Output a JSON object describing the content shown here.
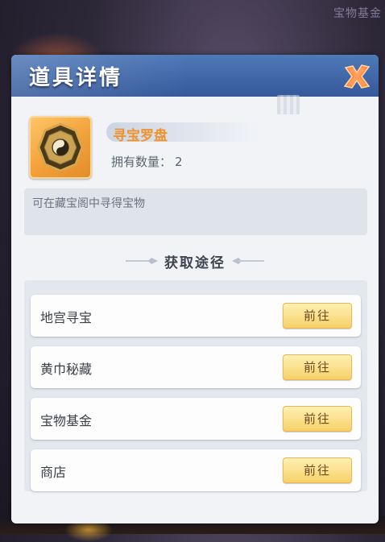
{
  "background": {
    "corner_text": "宝物基金"
  },
  "dialog": {
    "title": "道具详情",
    "close_icon": "close-x-icon",
    "accent_color": "#f0922e",
    "header_color": "#3f64a6"
  },
  "item": {
    "name": "寻宝罗盘",
    "icon": "compass-icon",
    "count_label": "拥有数量：",
    "count_value": "2",
    "description": "可在藏宝阁中寻得宝物"
  },
  "sources_section": {
    "title": "获取途径",
    "items": [
      {
        "label": "地宫寻宝",
        "button": "前往"
      },
      {
        "label": "黄巾秘藏",
        "button": "前往"
      },
      {
        "label": "宝物基金",
        "button": "前往"
      },
      {
        "label": "商店",
        "button": "前往"
      }
    ]
  }
}
